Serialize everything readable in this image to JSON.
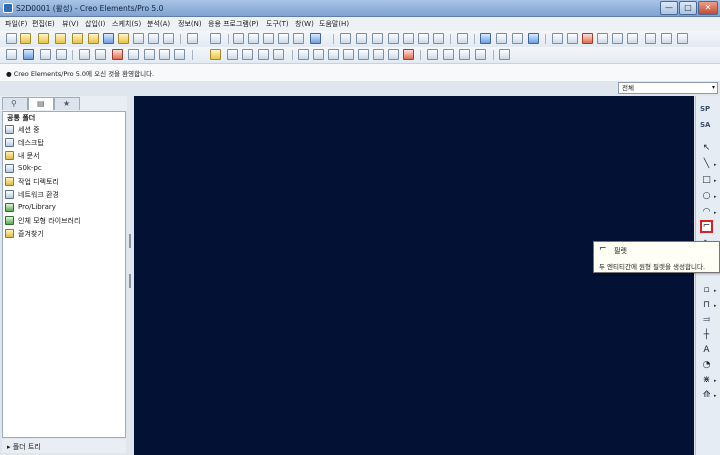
{
  "window": {
    "title": "S2D0001 (활성) - Creo Elements/Pro 5.0",
    "minimize_glyph": "—",
    "maximize_glyph": "□",
    "close_glyph": "✕"
  },
  "menu": [
    "파일(F)",
    "편집(E)",
    "뷰(V)",
    "삽입(I)",
    "스케치(S)",
    "분석(A)",
    "정보(N)",
    "응용 프로그램(P)",
    "도구(T)",
    "창(W)",
    "도움말(H)"
  ],
  "message_bar": {
    "text": "● Creo Elements/Pro 5.0에 오신 것을 환영합니다."
  },
  "filter": {
    "selected": "전체",
    "arrow": "▾"
  },
  "navigator": {
    "header": "공통 폴더",
    "items": [
      {
        "label": "세션 중",
        "icon": "session-icon"
      },
      {
        "label": "데스크탑",
        "icon": "desktop-icon"
      },
      {
        "label": "내 문서",
        "icon": "my-documents-icon"
      },
      {
        "label": "S0k-pc",
        "icon": "computer-icon"
      },
      {
        "label": "작업 디렉토리",
        "icon": "working-directory-icon"
      },
      {
        "label": "네트워크 환경",
        "icon": "network-icon"
      },
      {
        "label": "Pro/Library",
        "icon": "library-icon"
      },
      {
        "label": "인체 모형 라이브러리",
        "icon": "manikin-library-icon"
      },
      {
        "label": "즐겨찾기",
        "icon": "favorites-icon"
      }
    ],
    "folder_tree": "▸ 폴더 트리"
  },
  "right_toolbar": {
    "labels": [
      "SP",
      "SA"
    ],
    "tools": [
      {
        "glyph": "↖",
        "icon": "select-icon"
      },
      {
        "glyph": "╲",
        "icon": "line-icon"
      },
      {
        "glyph": "□",
        "icon": "rectangle-icon"
      },
      {
        "glyph": "○",
        "icon": "circle-icon"
      },
      {
        "glyph": "◠",
        "icon": "arc-icon"
      },
      {
        "glyph": "⌐",
        "icon": "fillet-icon"
      },
      {
        "glyph": "∿",
        "icon": "spline-icon"
      },
      {
        "glyph": "▫",
        "icon": "point-icon"
      },
      {
        "glyph": "⊓",
        "icon": "dimension-icon"
      },
      {
        "glyph": "⫤",
        "icon": "modify-icon"
      },
      {
        "glyph": "┼",
        "icon": "constraint-icon"
      },
      {
        "glyph": "A",
        "icon": "text-icon"
      },
      {
        "glyph": "◔",
        "icon": "palette-icon"
      },
      {
        "glyph": "⋇",
        "icon": "trim-icon"
      },
      {
        "glyph": "⟰",
        "icon": "mirror-icon"
      }
    ]
  },
  "tooltip": {
    "icon": "⌐",
    "title": "필렛",
    "description": "두 엔티티간에 원형 필렛을 생성합니다."
  }
}
